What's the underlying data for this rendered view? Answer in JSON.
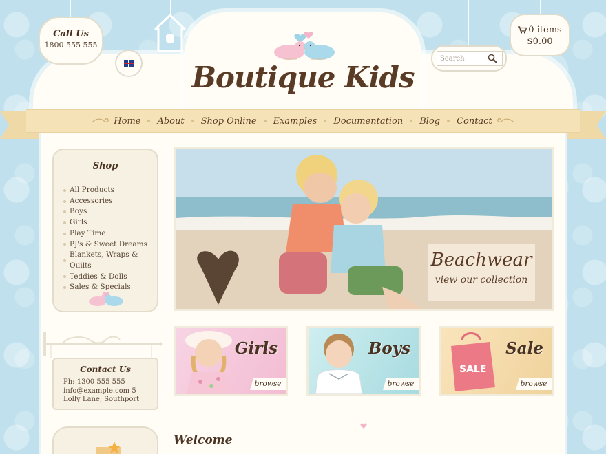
{
  "header": {
    "call_us_title": "Call Us",
    "call_us_phone": "1800 555 555",
    "logo": "Boutique Kids",
    "search_placeholder": "Search",
    "cart_items": "0 items",
    "cart_total": "$0.00"
  },
  "nav": {
    "items": [
      {
        "label": "Home"
      },
      {
        "label": "About"
      },
      {
        "label": "Shop Online"
      },
      {
        "label": "Examples"
      },
      {
        "label": "Documentation"
      },
      {
        "label": "Blog"
      },
      {
        "label": "Contact"
      }
    ]
  },
  "sidebar": {
    "shop_title": "Shop",
    "shop_items": [
      {
        "label": "All Products"
      },
      {
        "label": "Accessories"
      },
      {
        "label": "Boys"
      },
      {
        "label": "Girls"
      },
      {
        "label": "Play Time"
      },
      {
        "label": "PJ's & Sweet Dreams"
      },
      {
        "label": "Blankets, Wraps & Quilts"
      },
      {
        "label": "Teddies & Dolls"
      },
      {
        "label": "Sales & Specials"
      }
    ],
    "contact_title": "Contact Us",
    "contact_phone": "Ph: 1300 555 555",
    "contact_email_address": "info@example.com 5 Lolly Lane, Southport"
  },
  "hero": {
    "title": "Beachwear",
    "subtitle": "view our collection"
  },
  "categories": [
    {
      "title": "Girls",
      "browse": "browse"
    },
    {
      "title": "Boys",
      "browse": "browse"
    },
    {
      "title": "Sale",
      "browse": "browse",
      "badge": "SALE"
    }
  ],
  "main": {
    "welcome_heading": "Welcome"
  },
  "colors": {
    "background": "#bfe0ec",
    "ribbon": "#f5e2b6",
    "cream": "#fffdf6",
    "text_brown": "#5a3b26"
  }
}
